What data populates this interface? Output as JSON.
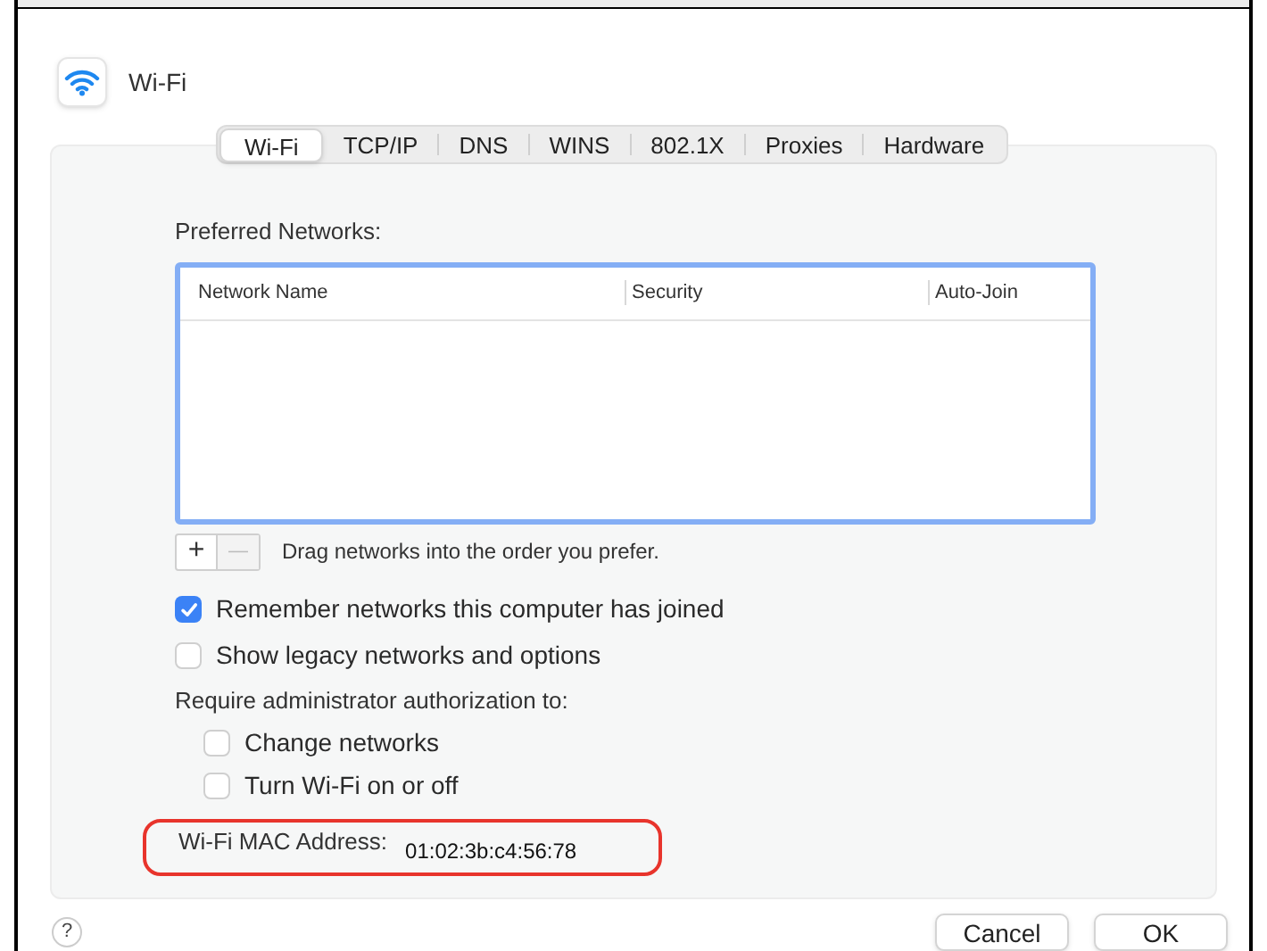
{
  "window": {
    "title": "Wi-Fi"
  },
  "tabs": [
    {
      "label": "Wi-Fi",
      "selected": true
    },
    {
      "label": "TCP/IP",
      "selected": false
    },
    {
      "label": "DNS",
      "selected": false
    },
    {
      "label": "WINS",
      "selected": false
    },
    {
      "label": "802.1X",
      "selected": false
    },
    {
      "label": "Proxies",
      "selected": false
    },
    {
      "label": "Hardware",
      "selected": false
    }
  ],
  "preferred_networks": {
    "label": "Preferred Networks:",
    "columns": [
      "Network Name",
      "Security",
      "Auto-Join"
    ],
    "add": "+",
    "remove": "—",
    "hint": "Drag networks into the order you prefer."
  },
  "options": [
    {
      "label": "Remember networks this computer has joined",
      "checked": true
    },
    {
      "label": "Show legacy networks and options",
      "checked": false
    }
  ],
  "admin": {
    "label": "Require administrator authorization to:",
    "options": [
      {
        "label": "Change networks",
        "checked": false
      },
      {
        "label": "Turn Wi-Fi on or off",
        "checked": false
      }
    ]
  },
  "mac": {
    "label": "Wi-Fi MAC Address:",
    "value": "01:02:3b:c4:56:78"
  },
  "help": "?",
  "buttons": [
    "Cancel",
    "OK"
  ]
}
